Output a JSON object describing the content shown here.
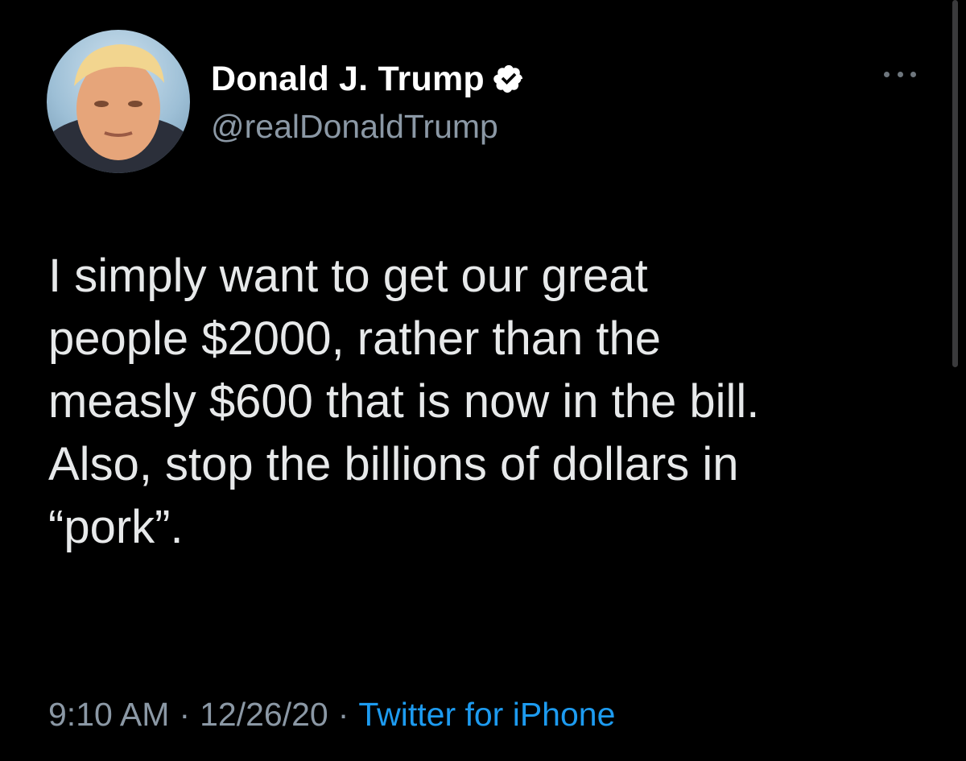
{
  "tweet": {
    "author": {
      "display_name": "Donald J. Trump",
      "handle": "@realDonaldTrump",
      "verified": true,
      "verified_color": "#ffffff"
    },
    "text": "I simply want to get our great\npeople $2000, rather than the\nmeasly $600 that is now in the bill.\nAlso, stop the billions of dollars in\n“pork”.",
    "time": "9:10 AM",
    "separator": "·",
    "date": "12/26/20",
    "source": "Twitter for iPhone",
    "more_icon": "more-horizontal-icon"
  },
  "colors": {
    "background": "#000000",
    "primary_text": "#e7e9ea",
    "secondary_text": "#8b98a5",
    "link": "#1d9bf0"
  }
}
